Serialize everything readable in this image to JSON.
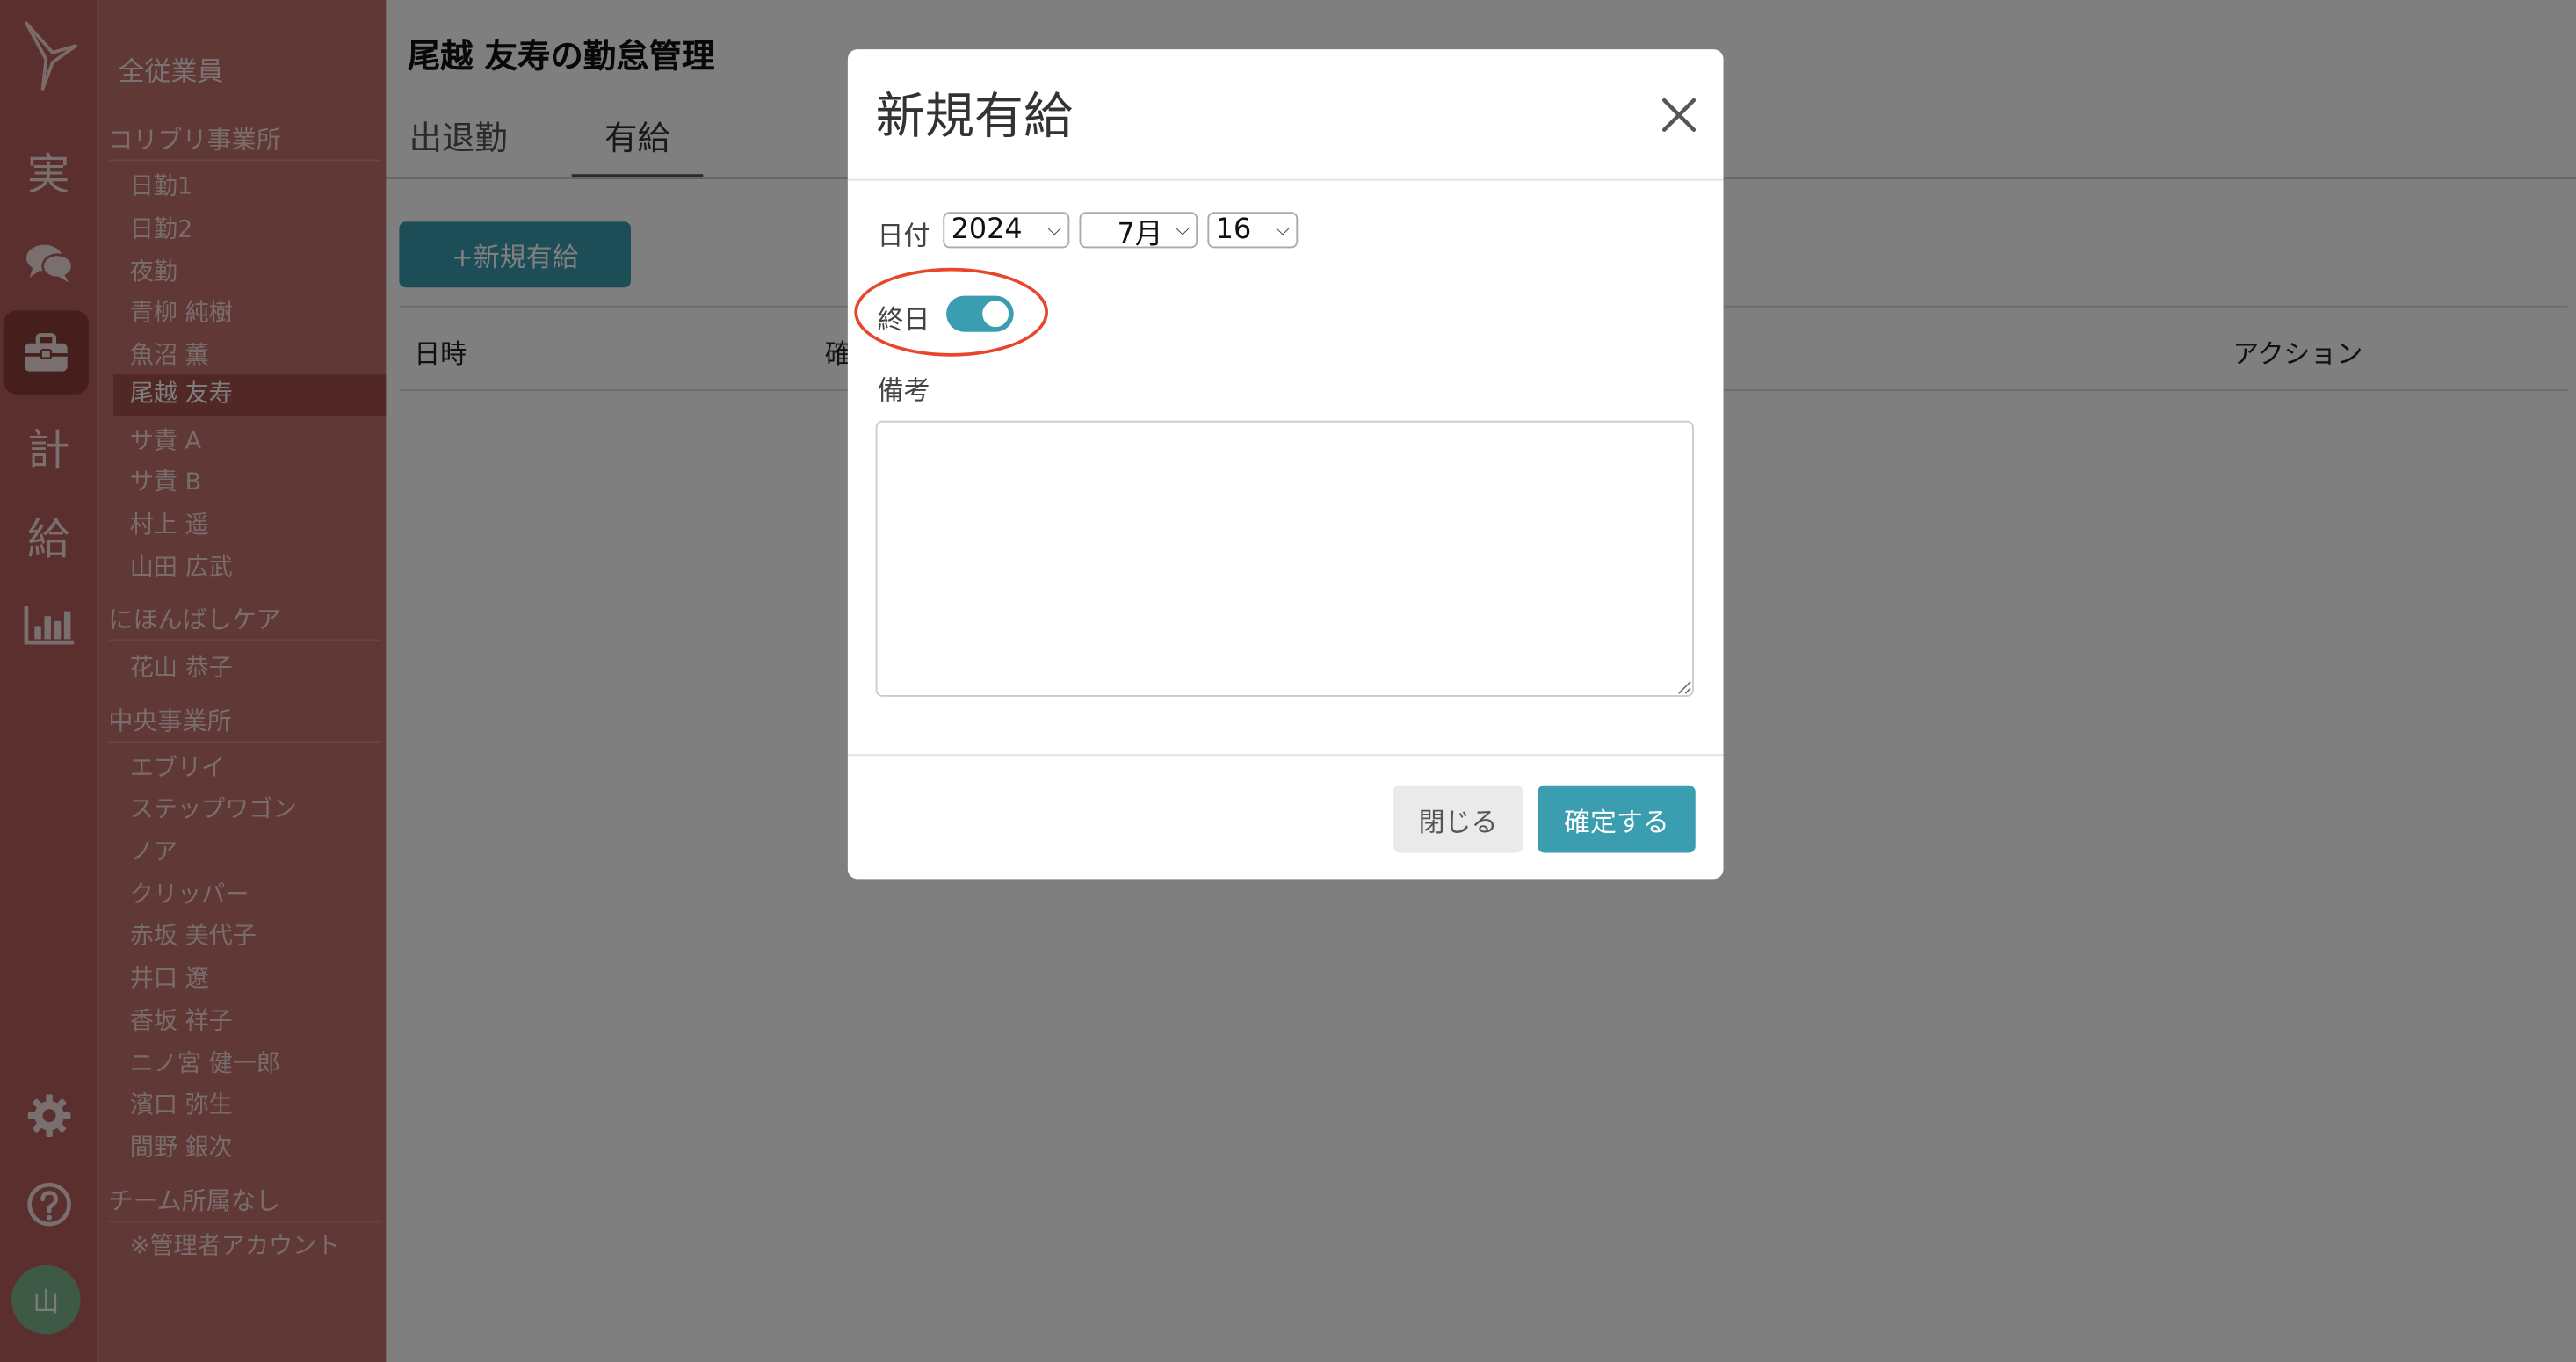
{
  "app": {
    "logo_name": "bird-logo",
    "accent_color": "#3a9db0",
    "sidebar_color": "#c0706b",
    "highlight_ring_color": "#e8452c"
  },
  "rail": {
    "items": [
      {
        "label": "実"
      },
      {
        "label": "comments"
      },
      {
        "label": "briefcase"
      },
      {
        "label": "計"
      },
      {
        "label": "給"
      },
      {
        "label": "chart"
      }
    ],
    "avatar": "山"
  },
  "sidebar": {
    "all_label": "全従業員",
    "groups": [
      {
        "title": "コリブリ事業所",
        "members": [
          "日勤1",
          "日勤2",
          "夜勤",
          "青柳 純樹",
          "魚沼 薫",
          "尾越 友寿",
          "サ責 A",
          "サ責 B",
          "村上 遥",
          "山田 広武"
        ]
      },
      {
        "title": "にほんばしケア",
        "members": [
          "花山 恭子"
        ]
      },
      {
        "title": "中央事業所",
        "members": [
          "エブリイ",
          "ステップワゴン",
          "ノア",
          "クリッパー",
          "赤坂 美代子",
          "井口 遼",
          "香坂 祥子",
          "ニノ宮 健一郎",
          "濱口 弥生",
          "間野 銀次"
        ]
      },
      {
        "title": "チーム所属なし",
        "members": [
          "※管理者アカウント"
        ]
      }
    ],
    "selected": "尾越 友寿"
  },
  "main": {
    "title": "尾越 友寿の勤怠管理",
    "tabs": [
      "出退勤",
      "有給"
    ],
    "active_tab": "有給",
    "add_button": "+新規有給",
    "table_headers": {
      "date": "日時",
      "confirm": "確",
      "action": "アクション"
    }
  },
  "modal": {
    "title": "新規有給",
    "date_label": "日付",
    "year": "2024",
    "month": "7月",
    "day": "16",
    "allday_label": "終日",
    "allday_on": true,
    "note_label": "備考",
    "note_value": "",
    "close_button": "閉じる",
    "confirm_button": "確定する"
  }
}
